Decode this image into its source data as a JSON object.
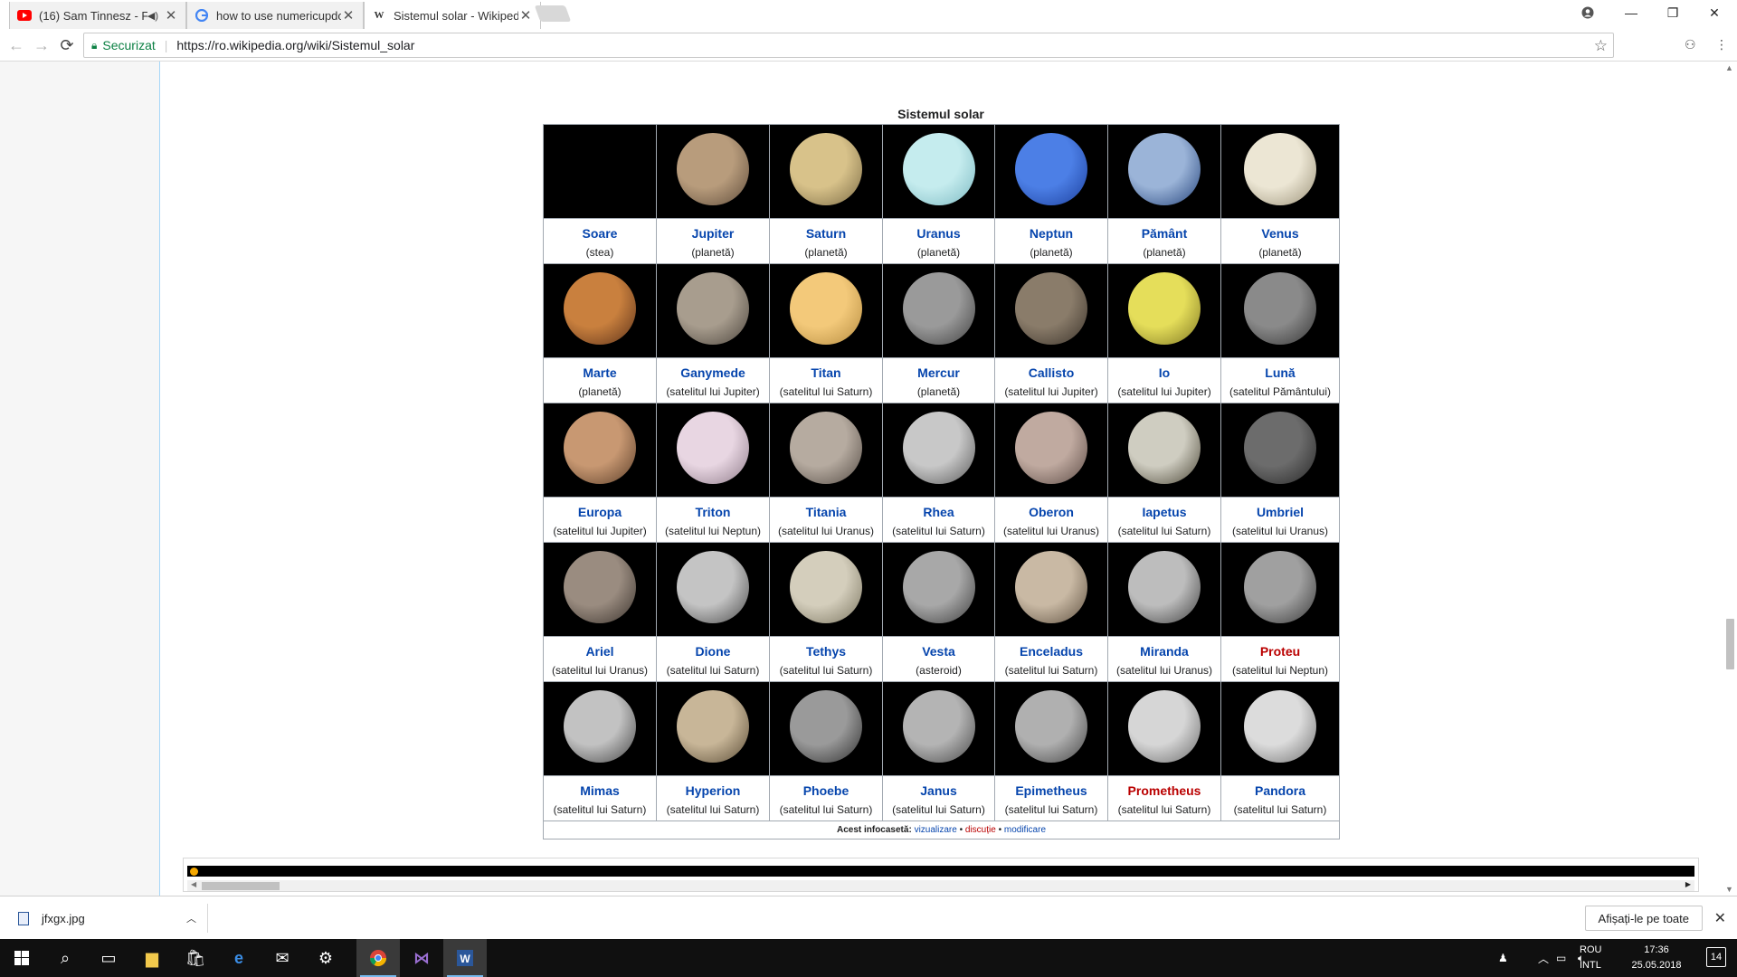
{
  "browser": {
    "tabs": [
      {
        "title": "(16) Sam Tinnesz - Fa",
        "favicon": "youtube-icon",
        "audio": true
      },
      {
        "title": "how to use numericupdo",
        "favicon": "google-icon",
        "audio": false
      },
      {
        "title": "Sistemul solar - Wikiped",
        "favicon": "wikipedia-icon",
        "audio": false
      }
    ],
    "security_label": "Securizat",
    "url": "https://ro.wikipedia.org/wiki/Sistemul_solar"
  },
  "infobox": {
    "caption": "Sistemul solar",
    "rows": [
      [
        {
          "name": "Soare",
          "desc": "(stea)",
          "link": "blue",
          "orb": "#000000",
          "edge": "#000000"
        },
        {
          "name": "Jupiter",
          "desc": "(planetă)",
          "link": "blue",
          "orb": "#b89c7c",
          "edge": "#5e4b3a"
        },
        {
          "name": "Saturn",
          "desc": "(planetă)",
          "link": "blue",
          "orb": "#d8c28a",
          "edge": "#7a6a44"
        },
        {
          "name": "Uranus",
          "desc": "(planetă)",
          "link": "blue",
          "orb": "#c5ecee",
          "edge": "#7bb9c2"
        },
        {
          "name": "Neptun",
          "desc": "(planetă)",
          "link": "blue",
          "orb": "#4c7fe6",
          "edge": "#1c3f9c"
        },
        {
          "name": "Pământ",
          "desc": "(planetă)",
          "link": "blue",
          "orb": "#9bb4d8",
          "edge": "#23427a"
        },
        {
          "name": "Venus",
          "desc": "(planetă)",
          "link": "blue",
          "orb": "#ece6d4",
          "edge": "#9a9178"
        }
      ],
      [
        {
          "name": "Marte",
          "desc": "(planetă)",
          "link": "blue",
          "orb": "#c9803e",
          "edge": "#5a3019"
        },
        {
          "name": "Ganymede",
          "desc": "(satelitul lui Jupiter)",
          "link": "blue",
          "orb": "#a89d8e",
          "edge": "#4b443c"
        },
        {
          "name": "Titan",
          "desc": "(satelitul lui Saturn)",
          "link": "blue",
          "orb": "#f3c97a",
          "edge": "#b48a3e"
        },
        {
          "name": "Mercur",
          "desc": "(planetă)",
          "link": "blue",
          "orb": "#9a9a9a",
          "edge": "#3f3f3f"
        },
        {
          "name": "Callisto",
          "desc": "(satelitul lui Jupiter)",
          "link": "blue",
          "orb": "#8a7c6a",
          "edge": "#3a322a"
        },
        {
          "name": "Io",
          "desc": "(satelitul lui Jupiter)",
          "link": "blue",
          "orb": "#e5de5a",
          "edge": "#7e7622"
        },
        {
          "name": "Lună",
          "desc": "(satelitul Pământului)",
          "link": "blue",
          "orb": "#8a8a8a",
          "edge": "#333333"
        }
      ],
      [
        {
          "name": "Europa",
          "desc": "(satelitul lui Jupiter)",
          "link": "blue",
          "orb": "#c89872",
          "edge": "#5a3d28"
        },
        {
          "name": "Triton",
          "desc": "(satelitul lui Neptun)",
          "link": "blue",
          "orb": "#e8d6e2",
          "edge": "#8d7a88"
        },
        {
          "name": "Titania",
          "desc": "(satelitul lui Uranus)",
          "link": "blue",
          "orb": "#b6aba0",
          "edge": "#544b44"
        },
        {
          "name": "Rhea",
          "desc": "(satelitul lui Saturn)",
          "link": "blue",
          "orb": "#c8c8c8",
          "edge": "#585858"
        },
        {
          "name": "Oberon",
          "desc": "(satelitul lui Uranus)",
          "link": "blue",
          "orb": "#c0aaa0",
          "edge": "#5b4a44"
        },
        {
          "name": "Iapetus",
          "desc": "(satelitul lui Saturn)",
          "link": "blue",
          "orb": "#cfcdc1",
          "edge": "#4a4535"
        },
        {
          "name": "Umbriel",
          "desc": "(satelitul lui Uranus)",
          "link": "blue",
          "orb": "#6c6c6c",
          "edge": "#262626"
        }
      ],
      [
        {
          "name": "Ariel",
          "desc": "(satelitul lui Uranus)",
          "link": "blue",
          "orb": "#9a8c80",
          "edge": "#3a322c"
        },
        {
          "name": "Dione",
          "desc": "(satelitul lui Saturn)",
          "link": "blue",
          "orb": "#c4c4c4",
          "edge": "#4a4a4a"
        },
        {
          "name": "Tethys",
          "desc": "(satelitul lui Saturn)",
          "link": "blue",
          "orb": "#d4cebc",
          "edge": "#7a745f"
        },
        {
          "name": "Vesta",
          "desc": "(asteroid)",
          "link": "blue",
          "orb": "#a8a8a8",
          "edge": "#3c3c3c"
        },
        {
          "name": "Enceladus",
          "desc": "(satelitul lui Saturn)",
          "link": "blue",
          "orb": "#c9b9a4",
          "edge": "#5e5040"
        },
        {
          "name": "Miranda",
          "desc": "(satelitul lui Uranus)",
          "link": "blue",
          "orb": "#bdbdbd",
          "edge": "#404040"
        },
        {
          "name": "Proteu",
          "desc": "(satelitul lui Neptun)",
          "link": "red",
          "orb": "#a0a0a0",
          "edge": "#383838"
        }
      ],
      [
        {
          "name": "Mimas",
          "desc": "(satelitul lui Saturn)",
          "link": "blue",
          "orb": "#c2c2c2",
          "edge": "#444444"
        },
        {
          "name": "Hyperion",
          "desc": "(satelitul lui Saturn)",
          "link": "blue",
          "orb": "#c8b698",
          "edge": "#5a4c36"
        },
        {
          "name": "Phoebe",
          "desc": "(satelitul lui Saturn)",
          "link": "blue",
          "orb": "#9a9a9a",
          "edge": "#2e2e2e"
        },
        {
          "name": "Janus",
          "desc": "(satelitul lui Saturn)",
          "link": "blue",
          "orb": "#b4b4b4",
          "edge": "#474747"
        },
        {
          "name": "Epimetheus",
          "desc": "(satelitul lui Saturn)",
          "link": "blue",
          "orb": "#b0b0b0",
          "edge": "#444444"
        },
        {
          "name": "Prometheus",
          "desc": "(satelitul lui Saturn)",
          "link": "red",
          "orb": "#d6d6d6",
          "edge": "#6a6a6a"
        },
        {
          "name": "Pandora",
          "desc": "(satelitul lui Saturn)",
          "link": "blue",
          "orb": "#dcdcdc",
          "edge": "#707070"
        }
      ]
    ],
    "footer_prefix": "Acest infocasetă:",
    "footer_links": [
      "vizualizare",
      "discuție",
      "modificare"
    ],
    "footer_sep": "•"
  },
  "download_shelf": {
    "file_name": "jfxgx.jpg",
    "show_all_label": "Afișați-le pe toate"
  },
  "taskbar": {
    "language_top": "ROU",
    "language_bottom": "INTL",
    "time": "17:36",
    "date": "25.05.2018",
    "notification_count": "14"
  },
  "colors": {
    "link_blue": "#0645ad",
    "link_red": "#ba0000",
    "secure_green": "#0b8043"
  }
}
